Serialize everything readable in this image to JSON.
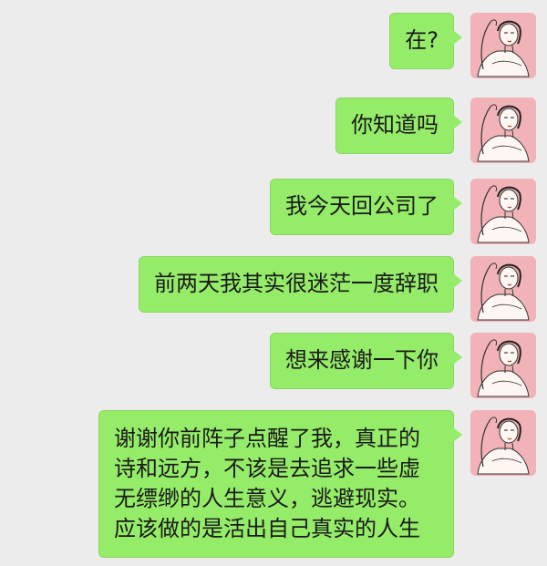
{
  "chat": {
    "messages": [
      {
        "text": "在?"
      },
      {
        "text": "你知道吗"
      },
      {
        "text": "我今天回公司了"
      },
      {
        "text": "前两天我其实很迷茫一度辞职"
      },
      {
        "text": "想来感谢一下你"
      },
      {
        "lines": [
          "谢谢你前阵子点醒了我，真正的",
          "诗和远方，不该是去追求一些虚",
          "无缥缈的人生意义，逃避现实。",
          "应该做的是活出自己真实的人生"
        ]
      }
    ]
  },
  "colors": {
    "background": "#ececec",
    "bubble": "#95ec69",
    "avatar_background": "#f2b3b8"
  },
  "icons": {
    "avatar": "woman-sketch-avatar-icon"
  }
}
